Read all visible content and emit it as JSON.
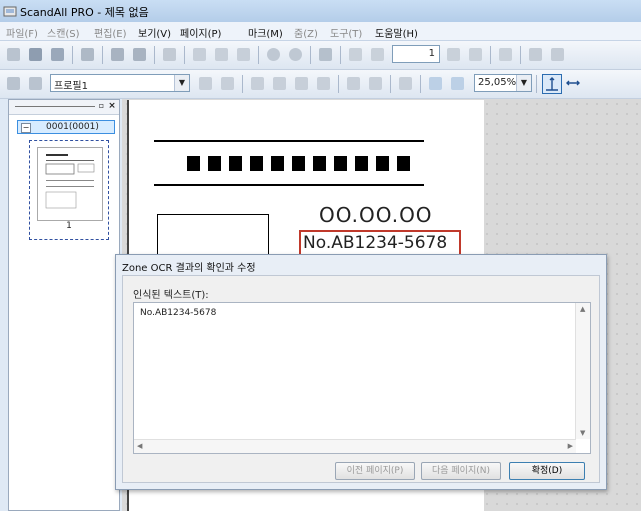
{
  "app": {
    "title": "ScandAll PRO - 제목 없음"
  },
  "menu": [
    {
      "label": "파일(F)",
      "enabled": false
    },
    {
      "label": "스캔(S)",
      "enabled": false
    },
    {
      "label": "편집(E)",
      "enabled": false
    },
    {
      "label": "보기(V)",
      "enabled": true
    },
    {
      "label": "페이지(P)",
      "enabled": true
    },
    {
      "label": "마크(M)",
      "enabled": true
    },
    {
      "label": "줌(Z)",
      "enabled": false
    },
    {
      "label": "도구(T)",
      "enabled": false
    },
    {
      "label": "도움말(H)",
      "enabled": true
    }
  ],
  "toolbar": {
    "page_number_value": "1",
    "profile_value": "프로필1",
    "zoom_value": "25,05%"
  },
  "thumbnails": {
    "group_label": "0001(0001)",
    "page_number": "1"
  },
  "document": {
    "circles_text": "OO.OO.OO",
    "id_field_text": "No.AB1234-5678"
  },
  "dialog": {
    "title": "Zone OCR 결과의 확인과 수정",
    "recognized_label": "인식된 텍스트(T):",
    "recognized_value": "No.AB1234-5678",
    "prev_button": "이전 페이지(P)",
    "next_button": "다음 페이지(N)",
    "ok_button": "확정(D)"
  },
  "colors": {
    "accent": "#3c8fe0",
    "ocr_highlight": "#c0392b"
  }
}
